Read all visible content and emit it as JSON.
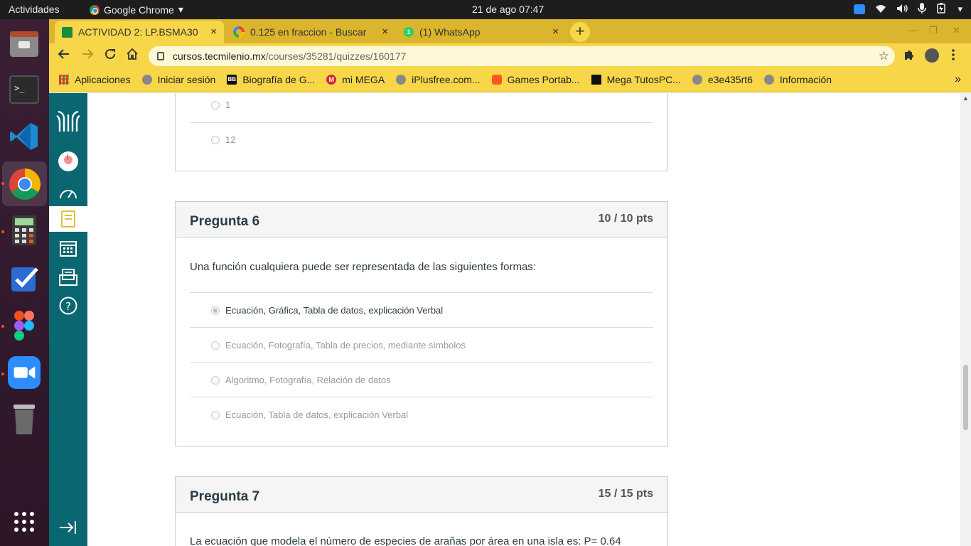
{
  "topbar": {
    "activities": "Actividades",
    "app_name": "Google Chrome",
    "app_menu_arrow": "▾",
    "clock": "21 de ago  07:47"
  },
  "tabs": [
    {
      "title": "ACTIVIDAD 2: LP.BSMA30",
      "favicon": "tecmilenio-icon",
      "active": true
    },
    {
      "title": "0.125 en fraccion - Buscar",
      "favicon": "google-icon",
      "active": false
    },
    {
      "title": "(1) WhatsApp",
      "favicon": "whatsapp-icon",
      "badge": "1",
      "active": false
    }
  ],
  "tab_close": "×",
  "new_tab": "+",
  "window_controls": {
    "minimize": "—",
    "maximize": "❐",
    "close": "✕"
  },
  "omnibox": {
    "domain": "cursos.tecmilenio.mx",
    "path": "/courses/35281/quizzes/160177"
  },
  "bookmarks": [
    {
      "label": "Aplicaciones",
      "icon": "apps-grid-icon"
    },
    {
      "label": "Iniciar sesión",
      "icon": "globe-icon"
    },
    {
      "label": "Biografía de G...",
      "icon": "bb-icon",
      "icon_text": "BB"
    },
    {
      "label": "mi MEGA",
      "icon": "mega-icon",
      "icon_text": "M"
    },
    {
      "label": "iPlusfree.com...",
      "icon": "globe-icon"
    },
    {
      "label": "Games Portab...",
      "icon": "blogger-icon"
    },
    {
      "label": "Mega TutosPC...",
      "icon": "mega-tutos-icon"
    },
    {
      "label": "e3e435rt6",
      "icon": "globe-icon"
    },
    {
      "label": "Información",
      "icon": "globe-icon"
    }
  ],
  "bookmarks_more": "»",
  "prev_question": {
    "answers": [
      {
        "text": "1",
        "selected": false
      },
      {
        "text": "12",
        "selected": false
      }
    ]
  },
  "question6": {
    "name": "Pregunta 6",
    "points": "10 / 10 pts",
    "text": "Una función cualquiera puede ser representada de las siguientes formas:",
    "answers": [
      {
        "text": "Ecuación, Gráfica, Tabla de datos, explicación Verbal",
        "selected": true
      },
      {
        "text": "Ecuación, Fotografía, Tabla de precios, mediante símbolos",
        "selected": false
      },
      {
        "text": "Algoritmo, Fotografía, Relación de datos",
        "selected": false
      },
      {
        "text": "Ecuación, Tabla de datos, explicación Verbal",
        "selected": false
      }
    ]
  },
  "question7": {
    "name": "Pregunta 7",
    "points": "15 / 15 pts",
    "text": "La ecuación que modela el número de especies de arañas por área en una isla es:  P= 0.64"
  },
  "colors": {
    "chrome_theme": "#f7d64a",
    "tabbar": "#dbb52d",
    "lms_nav": "#0a6670",
    "dock": "#3a1f35"
  }
}
